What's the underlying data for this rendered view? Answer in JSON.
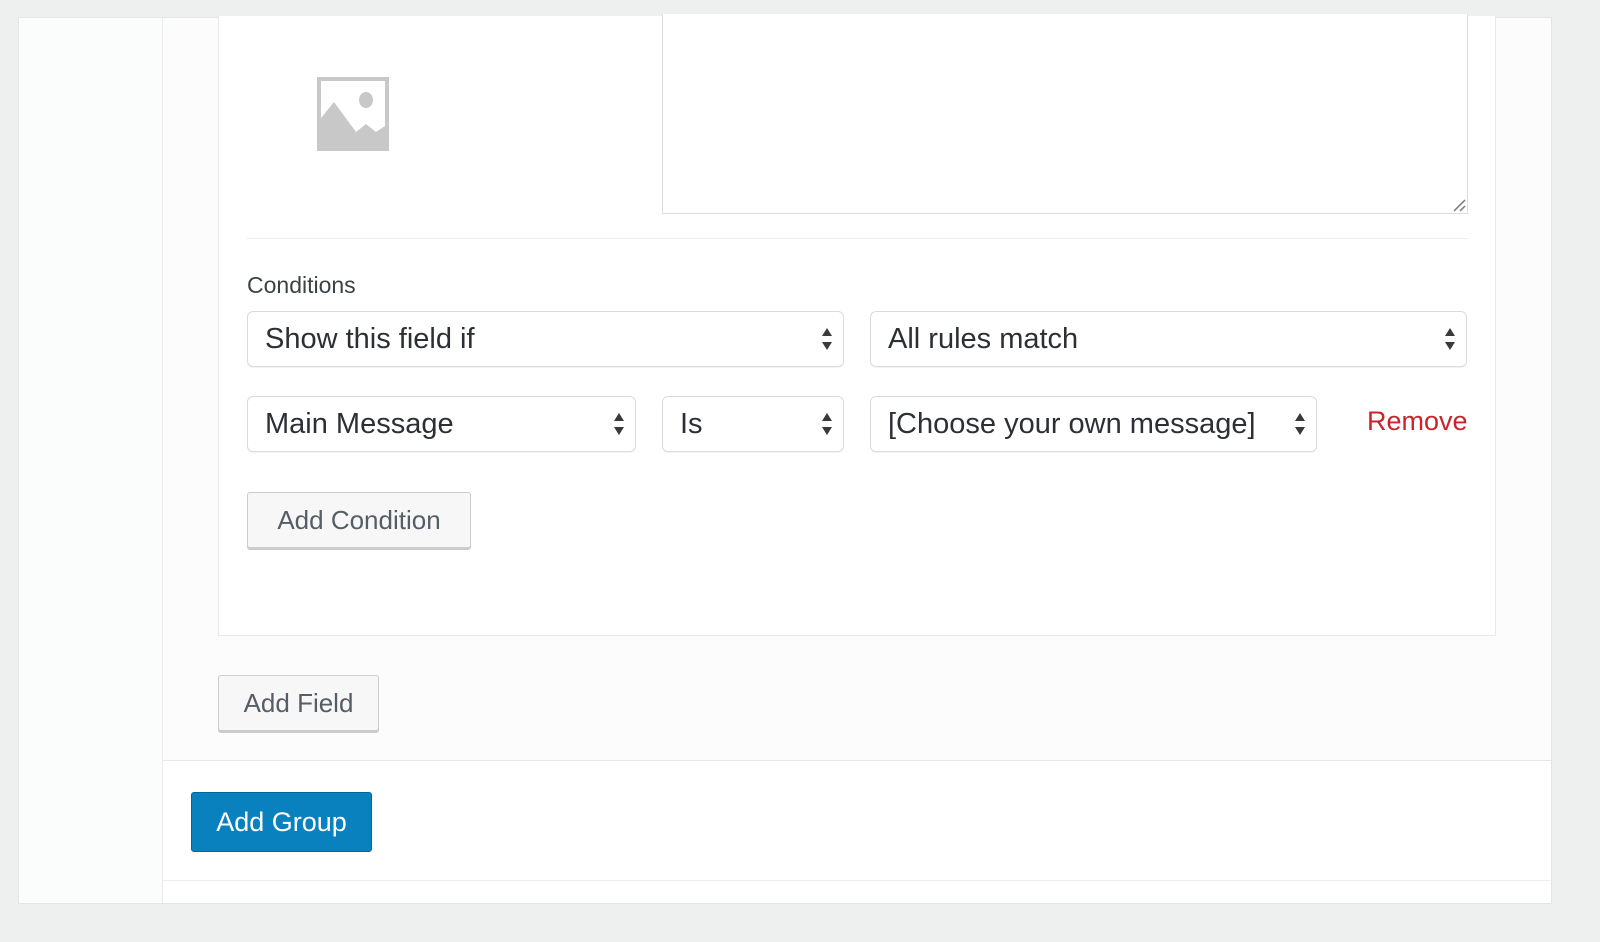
{
  "field": {
    "image_placeholder_icon": "image-placeholder-icon",
    "textarea_value": ""
  },
  "conditions": {
    "label": "Conditions",
    "action_select": {
      "value": "Show this field if"
    },
    "match_select": {
      "value": "All rules match"
    },
    "rules": [
      {
        "field_select": {
          "value": "Main Message"
        },
        "operator_select": {
          "value": "Is"
        },
        "value_select": {
          "value": "[Choose your own message]"
        },
        "remove_label": "Remove"
      }
    ],
    "add_condition_label": "Add Condition"
  },
  "add_field_label": "Add Field",
  "add_group_label": "Add Group",
  "colors": {
    "primary": "#0a81bf",
    "danger": "#c9232d",
    "background": "#eef0f0"
  }
}
